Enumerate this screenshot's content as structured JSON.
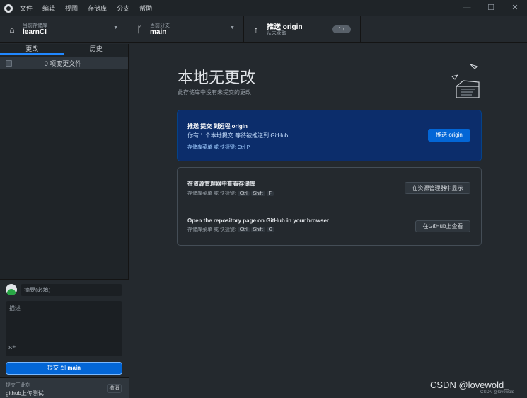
{
  "menubar": {
    "items": [
      "文件",
      "编辑",
      "视图",
      "存储库",
      "分支",
      "帮助"
    ]
  },
  "window_controls": {
    "minimize": "—",
    "maximize": "☐",
    "close": "✕"
  },
  "toolbar": {
    "repo": {
      "caption": "当前存储库",
      "value": "learnCI",
      "icon": "lock-icon"
    },
    "branch": {
      "caption": "当前分支",
      "value": "main",
      "icon": "branch-icon"
    },
    "push": {
      "title": "推送 origin",
      "subtitle": "从未获取",
      "badge": "1 ↑",
      "icon": "arrow-up-icon"
    }
  },
  "sidebar": {
    "tabs": [
      {
        "label": "更改",
        "selected": true
      },
      {
        "label": "历史",
        "selected": false
      }
    ],
    "changes_label": "0 项变更文件"
  },
  "commit": {
    "summary_placeholder": "摘要(必填)",
    "description_placeholder": "描述",
    "button_prefix": "提交 到 ",
    "button_branch": "main",
    "undo_caption": "提交于此刻",
    "undo_message": "github上传测试",
    "undo_button": "撤消"
  },
  "main": {
    "title": "本地无更改",
    "subtitle": "此存储库中没有未提交的更改",
    "push_card": {
      "heading": "推送 提交 到远程 origin",
      "description": "你有 1 个本地提交 等待被推送到 GitHub.",
      "shortcut": "存储库菜单 或 快捷键: Ctrl   P",
      "button": "推送 origin"
    },
    "explorer_card": {
      "heading": "在资源管理器中查看存储库",
      "shortcut_prefix": "存储库菜单 或 快捷键:",
      "keys": [
        "Ctrl",
        "Shift",
        "F"
      ],
      "button": "在资源管理器中显示"
    },
    "github_card": {
      "heading": "Open the repository page on GitHub in your browser",
      "shortcut_prefix": "存储库菜单 或 快捷键:",
      "keys": [
        "Ctrl",
        "Shift",
        "G"
      ],
      "button": "在GitHub上查看"
    }
  },
  "watermark": {
    "main": "CSDN @lovewold_",
    "small": "CSDN @lovewold_"
  }
}
